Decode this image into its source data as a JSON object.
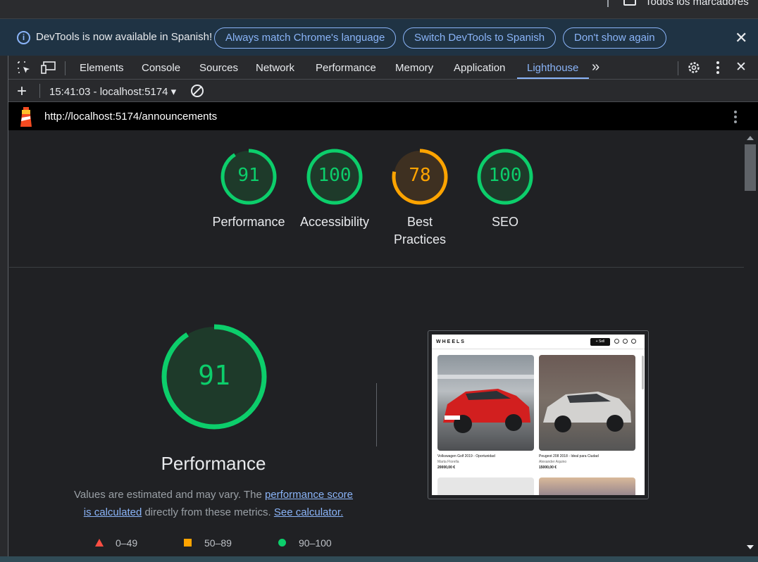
{
  "bookmarks": {
    "label": "Todos los marcadores"
  },
  "infobar": {
    "message": "DevTools is now available in Spanish!",
    "buttons": [
      "Always match Chrome's language",
      "Switch DevTools to Spanish",
      "Don't show again"
    ]
  },
  "tabs": [
    "Elements",
    "Console",
    "Sources",
    "Network",
    "Performance",
    "Memory",
    "Application",
    "Lighthouse"
  ],
  "active_tab": "Lighthouse",
  "subbar": {
    "report": "15:41:03 - localhost:5174"
  },
  "urlbar": {
    "url": "http://localhost:5174/announcements"
  },
  "scores": [
    {
      "label": "Performance",
      "value": "91",
      "fraction": 0.91,
      "status": "pass"
    },
    {
      "label": "Accessibility",
      "value": "100",
      "fraction": 1.0,
      "status": "pass"
    },
    {
      "label_line1": "Best",
      "label_line2": "Practices",
      "value": "78",
      "fraction": 0.78,
      "status": "average"
    },
    {
      "label": "SEO",
      "value": "100",
      "fraction": 1.0,
      "status": "pass"
    }
  ],
  "performance": {
    "value": "91",
    "fraction": 0.91,
    "title": "Performance",
    "desc_prefix": "Values are estimated and may vary. The ",
    "link1": "performance score is calculated",
    "desc_middle": " directly from these metrics. ",
    "link2": "See calculator."
  },
  "legend": [
    "0–49",
    "50–89",
    "90–100"
  ],
  "screenshot": {
    "logo": "WHEELS",
    "sell": "+ Sell",
    "cards": [
      {
        "title": "Volkswagen Golf 2019 - Oportunidad",
        "seller": "Marta Florella",
        "price": "20000,00 €"
      },
      {
        "title": "Peugeot 208 2018 - Ideal para Ciudad",
        "seller": "Alexander Aquino",
        "price": "15000,00 €"
      }
    ]
  },
  "colors": {
    "pass": "#0cce6b",
    "average": "#ffa400",
    "fail": "#ff4e42",
    "accent": "#8ab4f8"
  }
}
